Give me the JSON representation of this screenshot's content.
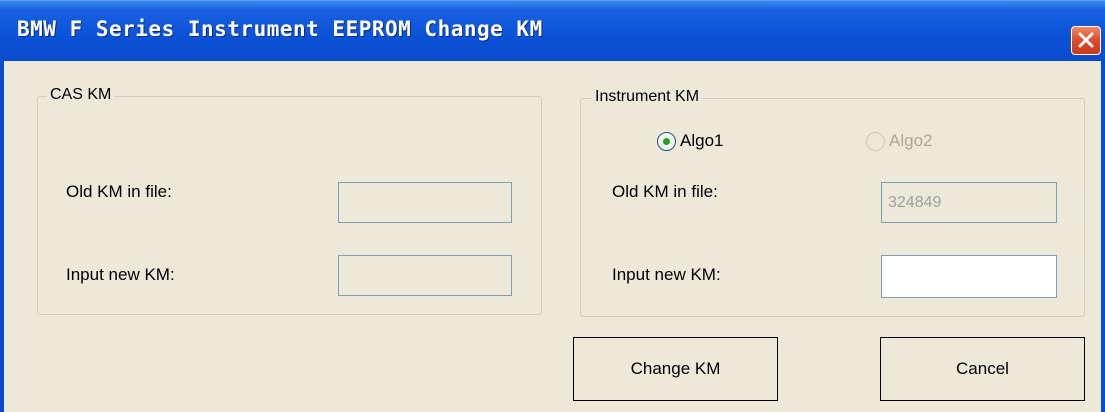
{
  "window": {
    "title": "BMW F Series Instrument EEPROM Change KM"
  },
  "cas_group": {
    "legend": "CAS KM",
    "old_km_label": "Old KM in file:",
    "old_km_value": "",
    "new_km_label": "Input new KM:",
    "new_km_value": ""
  },
  "instrument_group": {
    "legend": "Instrument KM",
    "algo1_label": "Algo1",
    "algo1_selected": true,
    "algo2_label": "Algo2",
    "algo2_enabled": false,
    "old_km_label": "Old KM in file:",
    "old_km_value": "324849",
    "new_km_label": "Input new KM:",
    "new_km_value": ""
  },
  "buttons": {
    "change": "Change KM",
    "cancel": "Cancel"
  },
  "colors": {
    "titlebar": "#0b52d8",
    "client": "#ece9d8",
    "close": "#e0502e",
    "radio_dot": "#21a121"
  }
}
